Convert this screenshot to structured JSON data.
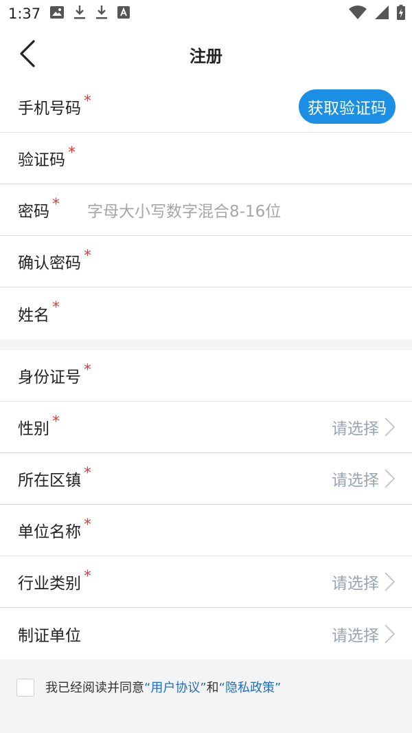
{
  "status_bar": {
    "time": "1:37",
    "left_icons": [
      "image-icon",
      "download-icon",
      "download-icon",
      "font-icon"
    ],
    "right_icons": [
      "wifi-icon",
      "signal-icon",
      "battery-charging-icon"
    ]
  },
  "nav": {
    "title": "注册",
    "back_icon": "chevron-left-icon"
  },
  "required_mark": "*",
  "get_code_label": "获取验证码",
  "rows": {
    "phone": {
      "label": "手机号码"
    },
    "code": {
      "label": "验证码"
    },
    "password": {
      "label": "密码",
      "placeholder": "字母大小写数字混合8-16位"
    },
    "confirm_password": {
      "label": "确认密码"
    },
    "name": {
      "label": "姓名"
    },
    "id_number": {
      "label": "身份证号"
    },
    "gender": {
      "label": "性别",
      "value": "请选择"
    },
    "town": {
      "label": "所在区镇",
      "value": "请选择"
    },
    "org_name": {
      "label": "单位名称"
    },
    "industry": {
      "label": "行业类别",
      "value": "请选择"
    },
    "issuer": {
      "label": "制证单位",
      "value": "请选择"
    }
  },
  "agreement": {
    "prefix": "我已经阅读并同意",
    "user_agreement": "“用户协议”",
    "and": "和",
    "privacy_policy": "“隐私政策”",
    "checked": false
  },
  "colors": {
    "accent": "#1a8fe3",
    "required": "#e53935",
    "link": "#1d6fc2",
    "placeholder": "#a6a6a6",
    "select_text": "#9aa5b0"
  }
}
